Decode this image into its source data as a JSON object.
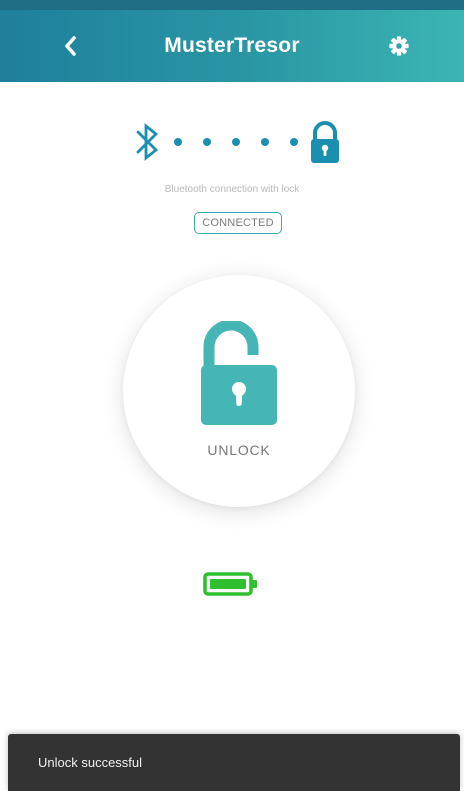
{
  "header": {
    "title": "MusterTresor",
    "back_icon": "chevron-left-icon",
    "settings_icon": "gear-icon",
    "gradient": [
      "#1f7f9c",
      "#3bb5b3"
    ]
  },
  "connection": {
    "bluetooth_icon": "bluetooth-icon",
    "lock_icon": "padlock-closed-icon",
    "caption": "Bluetooth connection with lock",
    "status": "CONNECTED",
    "accent": "#1a8fb0"
  },
  "unlock": {
    "icon": "padlock-open-icon",
    "label": "UNLOCK",
    "icon_color": "#45b5b5"
  },
  "battery": {
    "icon": "battery-icon",
    "level": 1.0,
    "color": "#2fc02f"
  },
  "snackbar": {
    "message": "Unlock successful"
  }
}
